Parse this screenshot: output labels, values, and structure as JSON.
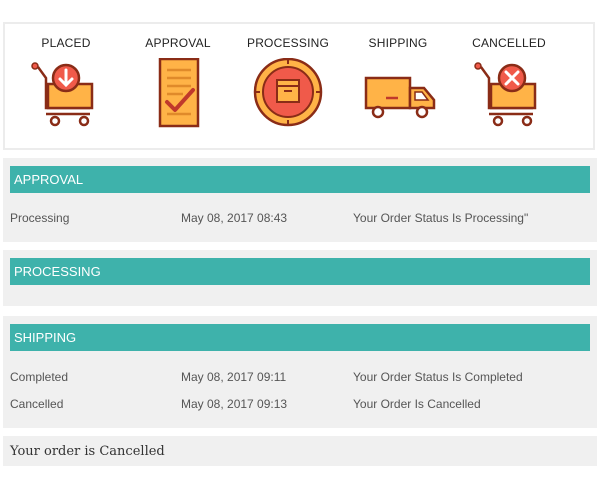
{
  "steps": [
    {
      "label": "PLACED",
      "icon": "cart-download-icon"
    },
    {
      "label": "APPROVAL",
      "icon": "checklist-icon"
    },
    {
      "label": "PROCESSING",
      "icon": "box-target-icon"
    },
    {
      "label": "SHIPPING",
      "icon": "truck-icon"
    },
    {
      "label": "CANCELLED",
      "icon": "cart-cancel-icon"
    }
  ],
  "colors": {
    "accent": "#3eb2ab",
    "icon_fill": "#ffb347",
    "icon_red": "#f05a4a",
    "icon_stroke": "#8a2c17"
  },
  "panels": {
    "approval": {
      "title": "APPROVAL",
      "rows": [
        {
          "status": "Processing",
          "date": "May 08, 2017 08:43",
          "message": "Your Order Status Is Processing\""
        }
      ]
    },
    "processing": {
      "title": "PROCESSING",
      "rows": []
    },
    "shipping": {
      "title": "SHIPPING",
      "rows": [
        {
          "status": "Completed",
          "date": "May 08, 2017 09:11",
          "message": "Your Order Status Is Completed"
        },
        {
          "status": "Cancelled",
          "date": "May 08, 2017 09:13",
          "message": "Your Order Is Cancelled"
        }
      ]
    }
  },
  "final_message": "Your order is Cancelled"
}
